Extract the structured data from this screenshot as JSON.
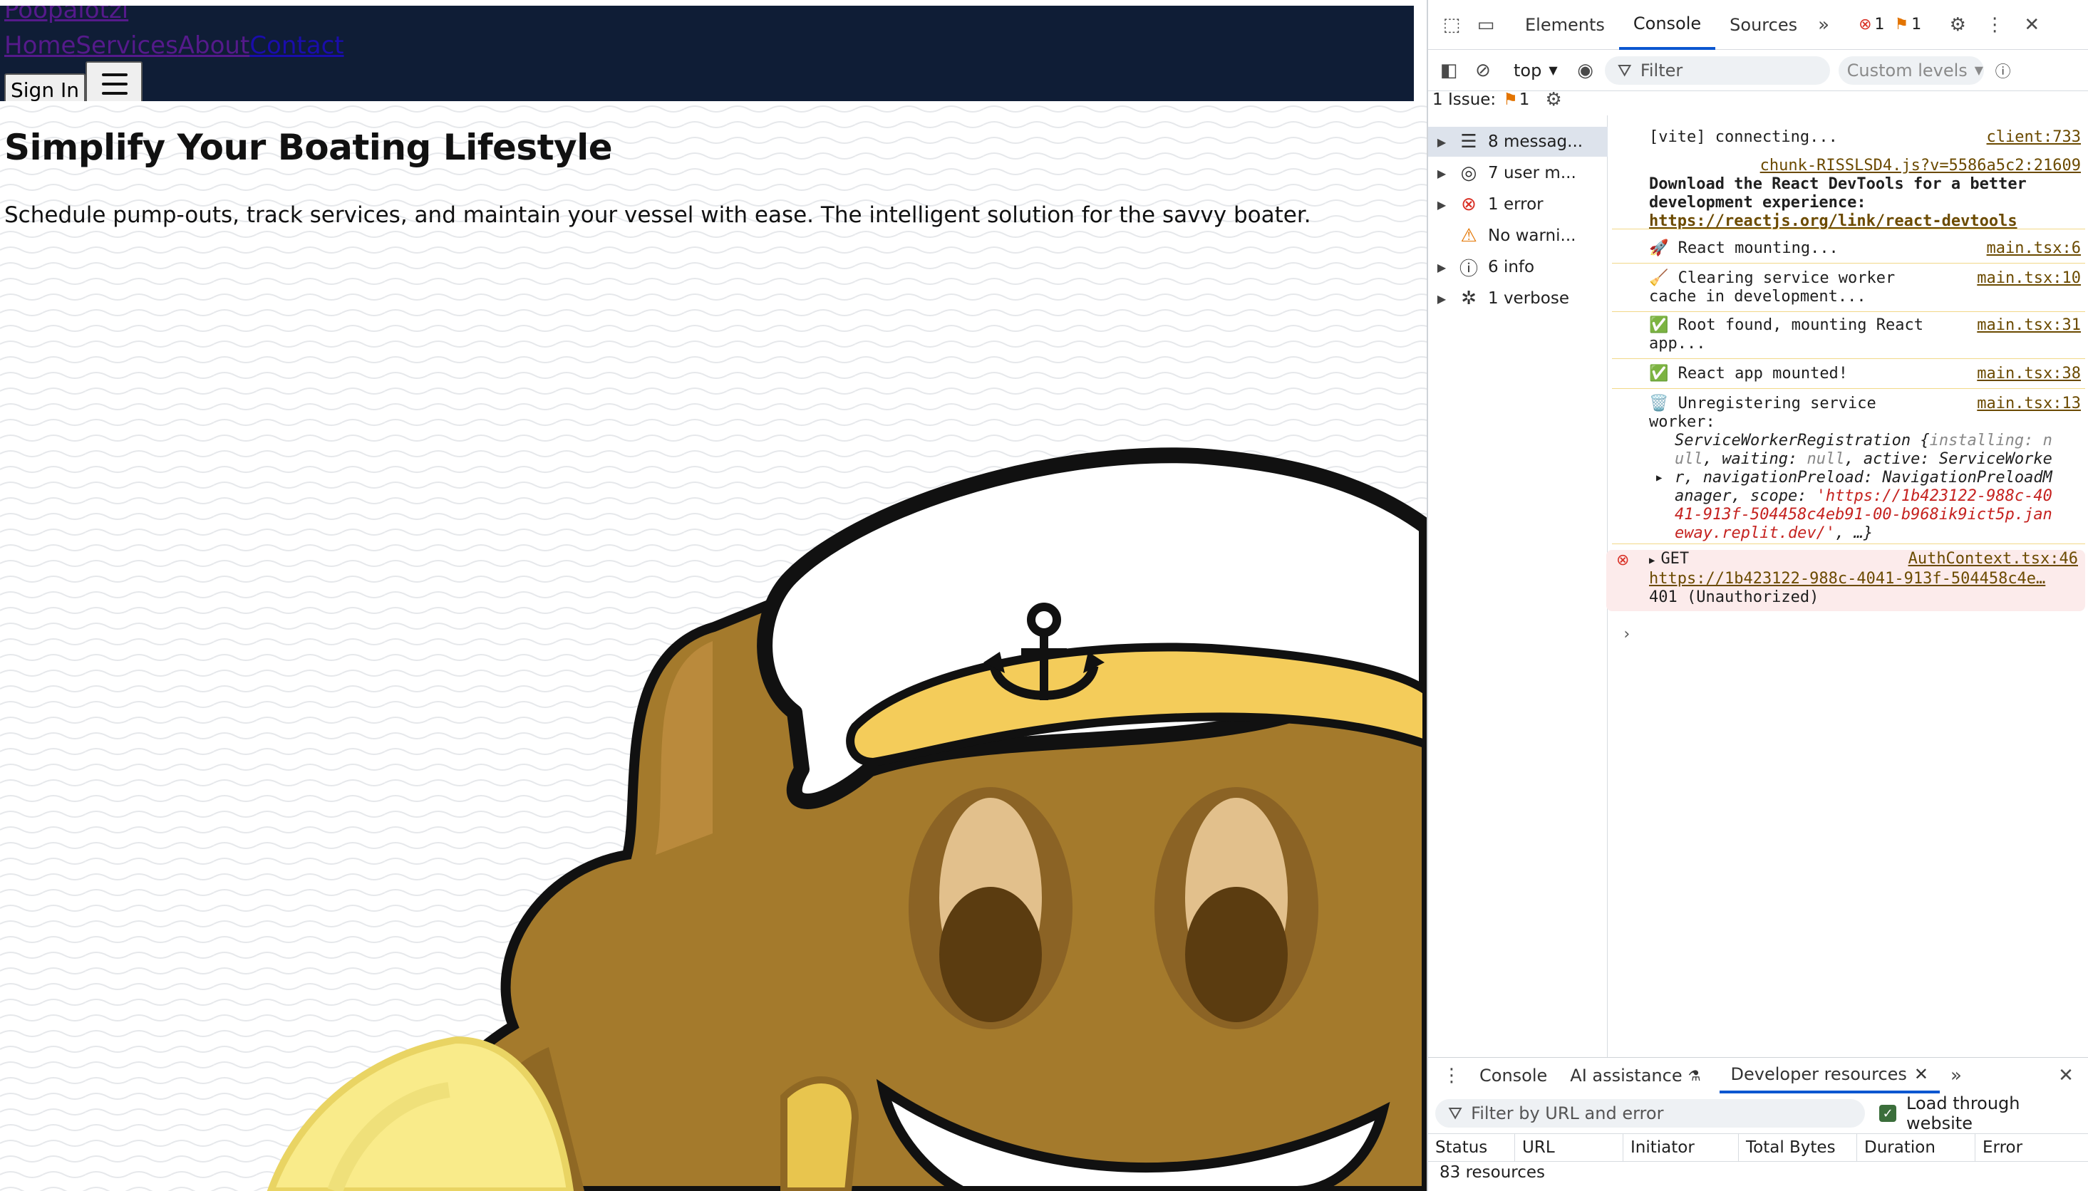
{
  "site": {
    "brand": "Poopalotzi",
    "nav": [
      "Home",
      "Services",
      "About",
      "Contact"
    ],
    "sign_in": "Sign In",
    "hero_title": "Simplify Your Boating Lifestyle",
    "hero_subtitle": "Schedule pump-outs, track services, and maintain your vessel with ease. The intelligent solution for the savvy boater."
  },
  "devtools": {
    "tabs": [
      "Elements",
      "Console",
      "Sources"
    ],
    "active_tab": "Console",
    "error_count": "1",
    "warning_count": "1",
    "context": "top",
    "filter_placeholder": "Filter",
    "levels": "Custom levels",
    "issues_label": "1 Issue:",
    "issues_count": "1",
    "sidebar": [
      {
        "label": "8 messag...",
        "icon": "list-icon"
      },
      {
        "label": "7 user m...",
        "icon": "user-icon"
      },
      {
        "label": "1 error",
        "icon": "error-icon"
      },
      {
        "label": "No warni...",
        "icon": "warning-icon"
      },
      {
        "label": "6 info",
        "icon": "info-icon"
      },
      {
        "label": "1 verbose",
        "icon": "bug-icon"
      }
    ],
    "logs": {
      "vite": "[vite] connecting...",
      "vite_src": "client:733",
      "chunk_src": "chunk-RISSLSD4.js?v=5586a5c2:21609",
      "devtools_line1": "Download the React DevTools for a better",
      "devtools_line2": "development experience:",
      "devtools_link": "https://reactjs.org/link/react-devtools",
      "mounting": "🚀 React mounting...",
      "mounting_src": "main.tsx:6",
      "clearing_1": "🧹 Clearing service worker",
      "clearing_2": "cache in development...",
      "clearing_src": "main.tsx:10",
      "root_1": "✅ Root found, mounting React",
      "root_2": "app...",
      "root_src": "main.tsx:31",
      "mounted": "✅ React app mounted!",
      "mounted_src": "main.tsx:38",
      "unreg_1": "🗑️ Unregistering service",
      "unreg_2": "worker:",
      "unreg_src": "main.tsx:13",
      "sw_1a": "ServiceWorkerRegistration {",
      "sw_1b": "installing: n",
      "sw_2a": "ull",
      "sw_2b": ", waiting: ",
      "sw_2c": "null",
      "sw_2d": ", active: ",
      "sw_2e": "ServiceWorke",
      "sw_3": "r, navigationPreload: NavigationPreloadM",
      "sw_4a": "anager, scope: ",
      "sw_4b": "'https://1b423122-988c-40",
      "sw_5": "41-913f-504458c4eb91-00-b968ik9ict5p.jan",
      "sw_6a": "eway.replit.dev/'",
      "sw_6b": ", …}",
      "get": "GET",
      "get_src": "AuthContext.tsx:46",
      "get_url": "https://1b423122-988c-4041-913f-504458c4e…",
      "get_status": "401 (Unauthorized)"
    },
    "drawer": {
      "tabs": [
        "Console",
        "AI assistance",
        "Developer resources"
      ],
      "active_tab": "Developer resources",
      "filter_placeholder": "Filter by URL and error",
      "load_through": "Load through website",
      "columns": [
        "Status",
        "URL",
        "Initiator",
        "Total Bytes",
        "Duration",
        "Error"
      ],
      "resource_count": "83 resources"
    }
  }
}
